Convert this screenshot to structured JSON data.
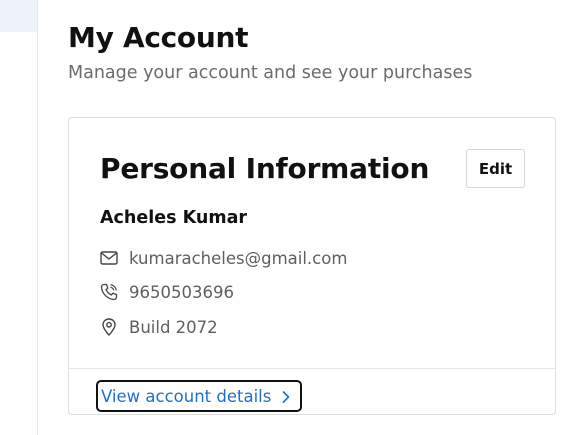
{
  "header": {
    "title": "My Account",
    "subtitle": "Manage your account and see your purchases"
  },
  "personal_info": {
    "title": "Personal Information",
    "edit_label": "Edit",
    "name": "Acheles Kumar",
    "email": "kumaracheles@gmail.com",
    "phone": "9650503696",
    "address": "Build 2072",
    "icons": {
      "email": "mail-icon",
      "phone": "phone-icon",
      "address": "location-pin-icon",
      "link": "chevron-right-icon"
    }
  },
  "footer_link": {
    "label": "View account details"
  },
  "colors": {
    "link": "#1f6fd1",
    "muted_text": "#6b6b6b",
    "border": "#dedede"
  }
}
